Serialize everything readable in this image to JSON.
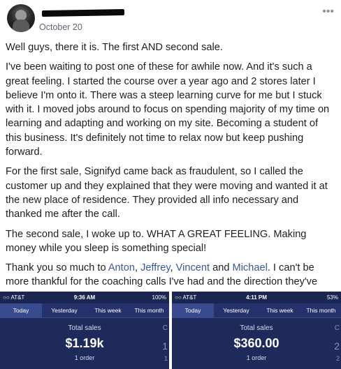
{
  "post": {
    "author_redacted": true,
    "date": "October 20",
    "more_icon": "more-horizontal-icon",
    "paragraphs": [
      "Well guys, there it is. The first AND second sale.",
      "I've been waiting to post one of these for awhile now. And it's such a great feeling. I started the course over a year ago and 2 stores later I believe I'm onto it. There was a steep learning curve for me but I stuck with it. I moved jobs around to focus on spending majority of my time on learning and adapting and working on my site. Becoming a student of this business. It's definitely not time to relax now but keep pushing forward.",
      "For the first sale, Signifyd came back as fraudulent, so I called the customer up and they explained that they were moving and wanted it at the new place of residence. They provided all info necessary and thanked me after the call.",
      "The second sale, I woke up to. WHAT A GREAT FEELING. Making money while you sleep is something special!"
    ],
    "thanks": {
      "prefix": "Thank you so much to ",
      "mention1": "Anton",
      "sep1": ", ",
      "mention2": "Jeffrey",
      "sep2": ", ",
      "mention3": "Vincent",
      "sep3": " and ",
      "mention4": "Michael",
      "suffix": ". I can't be more thankful for the coaching calls I've had and the direction they've pointed me in."
    }
  },
  "screenshots": [
    {
      "carrier": "○○ AT&T",
      "time": "9:36 AM",
      "battery": "100%",
      "tabs": [
        "Today",
        "Yesterday",
        "This week",
        "This month"
      ],
      "active_tab": "Today",
      "label": "Total sales",
      "value": "$1.19k",
      "orders": "1 order",
      "edge": [
        "C",
        "1",
        "1"
      ]
    },
    {
      "carrier": "○○ AT&T",
      "time": "4:11 PM",
      "battery": "53%",
      "tabs": [
        "Today",
        "Yesterday",
        "This week",
        "This month"
      ],
      "active_tab": "Today",
      "label": "Total sales",
      "value": "$360.00",
      "orders": "1 order",
      "edge": [
        "C",
        "2",
        "2"
      ]
    }
  ],
  "colors": {
    "text": "#1c1e21",
    "muted": "#606770",
    "mention": "#385898",
    "app_bg": "#1e2a5a"
  }
}
